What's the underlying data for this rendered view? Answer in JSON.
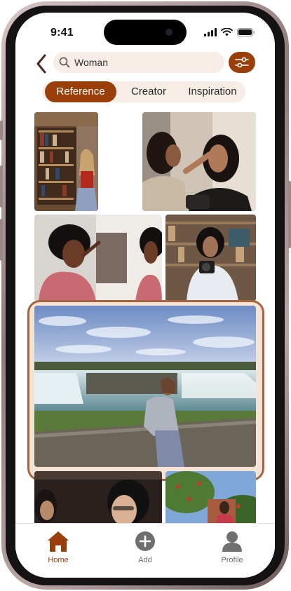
{
  "status_bar": {
    "time": "9:41"
  },
  "search": {
    "query": "Woman"
  },
  "tabs": [
    {
      "label": "Reference",
      "active": true
    },
    {
      "label": "Creator",
      "active": false
    },
    {
      "label": "Inspiration",
      "active": false
    }
  ],
  "gallery": {
    "selected_index": 4,
    "images": [
      {
        "description": "woman-in-library"
      },
      {
        "description": "women-applying-makeup"
      },
      {
        "description": "woman-makeup-mirror"
      },
      {
        "description": "woman-holding-camera"
      },
      {
        "description": "woman-at-niagara-falls"
      },
      {
        "description": "women-portrait-dark"
      },
      {
        "description": "person-picking-fruit"
      }
    ]
  },
  "bottom_nav": [
    {
      "label": "Home",
      "icon": "home-icon",
      "active": true
    },
    {
      "label": "Add",
      "icon": "add-circle-icon",
      "active": false
    },
    {
      "label": "Profile",
      "icon": "profile-icon",
      "active": false
    }
  ],
  "colors": {
    "accent": "#9a3e0a",
    "accent_soft": "#f7ece6",
    "highlight_border": "#a5643f"
  }
}
